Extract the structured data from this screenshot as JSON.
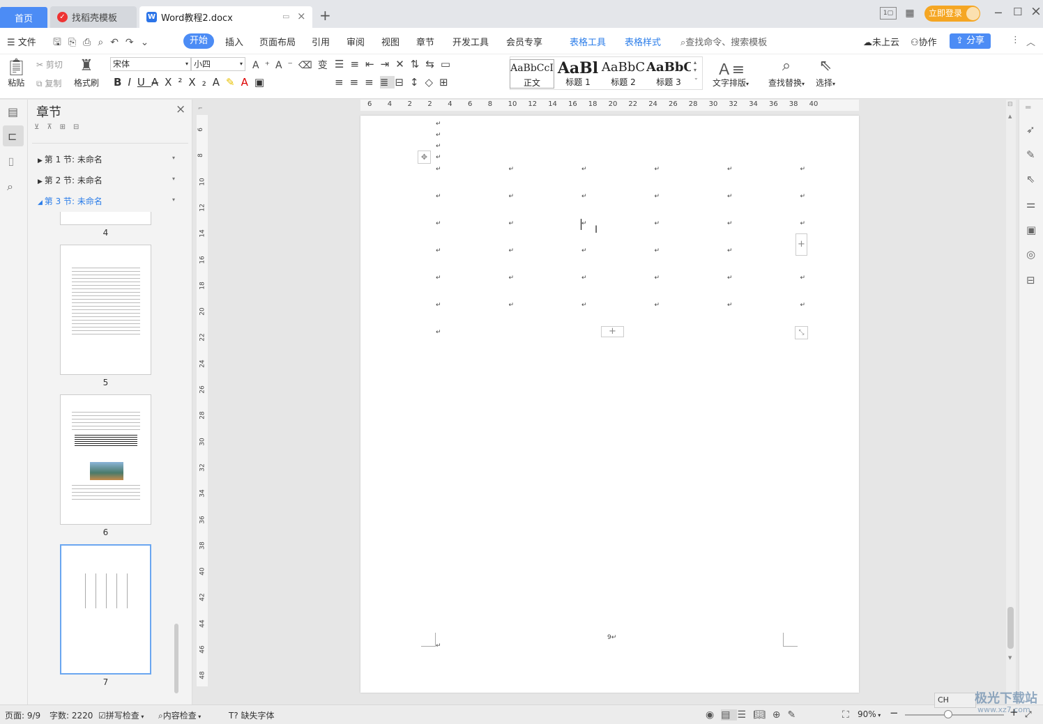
{
  "tabs": {
    "home": "首页",
    "daoke": "找稻壳模板",
    "doc": "Word教程2.docx"
  },
  "titlebar": {
    "login": "立即登录"
  },
  "menu": {
    "file": "文件",
    "start": "开始",
    "insert": "插入",
    "layout": "页面布局",
    "ref": "引用",
    "review": "审阅",
    "view": "视图",
    "chapter": "章节",
    "dev": "开发工具",
    "vip": "会员专享",
    "table_tools": "表格工具",
    "table_style": "表格样式",
    "search_placeholder": "查找命令、搜索模板",
    "cloud": "未上云",
    "collab": "协作",
    "share": "分享"
  },
  "ribbon": {
    "paste": "粘贴",
    "cut": "剪切",
    "copy": "复制",
    "format_painter": "格式刷",
    "font": "宋体",
    "size": "小四",
    "text_layout": "文字排版",
    "find_replace": "查找替换",
    "select": "选择",
    "styles": [
      {
        "preview": "AaBbCcI",
        "name": "正文"
      },
      {
        "preview": "AaBl",
        "name": "标题 1"
      },
      {
        "preview": "AaBbC",
        "name": "标题 2"
      },
      {
        "preview": "AaBbC",
        "name": "标题 3"
      }
    ]
  },
  "nav": {
    "title": "章节",
    "sections": [
      "第 1 节: 未命名",
      "第 2 节: 未命名",
      "第 3 节: 未命名"
    ],
    "pages": [
      "4",
      "5",
      "6",
      "7"
    ]
  },
  "ruler": {
    "h": [
      "6",
      "4",
      "2",
      "2",
      "4",
      "6",
      "8",
      "10",
      "12",
      "14",
      "16",
      "18",
      "20",
      "22",
      "24",
      "26",
      "28",
      "30",
      "32",
      "34",
      "36",
      "38",
      "40"
    ],
    "v": [
      "6",
      "8",
      "10",
      "12",
      "14",
      "16",
      "18",
      "20",
      "22",
      "24",
      "26",
      "28",
      "30",
      "32",
      "34",
      "36",
      "38",
      "40",
      "42",
      "44",
      "46",
      "48"
    ]
  },
  "doc": {
    "page_number": "9"
  },
  "status": {
    "page": "页面: 9/9",
    "words": "字数: 2220",
    "spell": "拼写检查",
    "content_check": "内容检查",
    "missing_font": "缺失字体",
    "zoom": "90%",
    "ime": "CH",
    "watermark": "极光下载站",
    "watermark_url": "www.xz7.com"
  }
}
